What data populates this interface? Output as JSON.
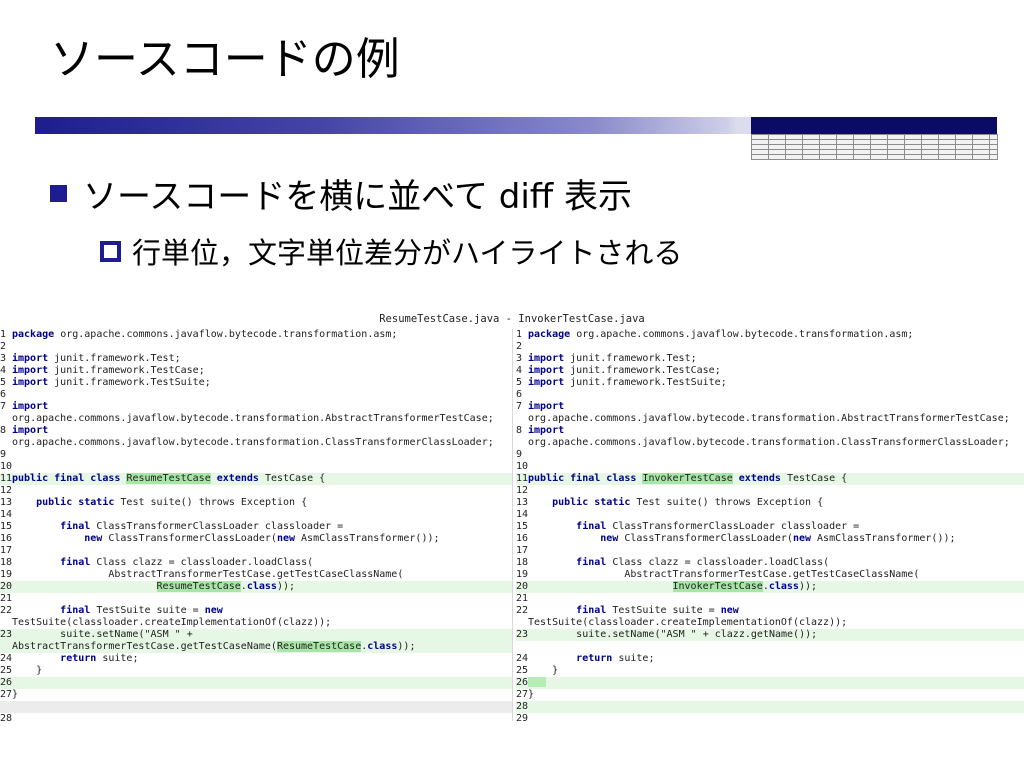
{
  "slide": {
    "title": "ソースコードの例",
    "bullet1": "ソースコードを横に並べて diff 表示",
    "bullet2": "行単位，文字単位差分がハイライトされる"
  },
  "colors": {
    "accent": "#1d1d8f",
    "diff_line_bg": "#e6f7e6",
    "diff_word_bg": "#a8e6a8",
    "keyword": "#00008b"
  },
  "diff": {
    "title": "ResumeTestCase.java - InvokerTestCase.java",
    "left_class": "ResumeTestCase",
    "right_class": "InvokerTestCase",
    "left": [
      {
        "n": "1",
        "t": "package org.apache.commons.javaflow.bytecode.transformation.asm;"
      },
      {
        "n": "2",
        "t": ""
      },
      {
        "n": "3",
        "t": "import junit.framework.Test;"
      },
      {
        "n": "4",
        "t": "import junit.framework.TestCase;"
      },
      {
        "n": "5",
        "t": "import junit.framework.TestSuite;"
      },
      {
        "n": "6",
        "t": ""
      },
      {
        "n": "7",
        "t": "import"
      },
      {
        "n": "",
        "t": "org.apache.commons.javaflow.bytecode.transformation.AbstractTransformerTestCase;"
      },
      {
        "n": "8",
        "t": "import"
      },
      {
        "n": "",
        "t": "org.apache.commons.javaflow.bytecode.transformation.ClassTransformerClassLoader;"
      },
      {
        "n": "9",
        "t": ""
      },
      {
        "n": "10",
        "t": ""
      },
      {
        "n": "11",
        "t": "public final class ResumeTestCase extends TestCase {",
        "hl": true
      },
      {
        "n": "12",
        "t": ""
      },
      {
        "n": "13",
        "t": "    public static Test suite() throws Exception {"
      },
      {
        "n": "14",
        "t": ""
      },
      {
        "n": "15",
        "t": "        final ClassTransformerClassLoader classloader ="
      },
      {
        "n": "16",
        "t": "            new ClassTransformerClassLoader(new AsmClassTransformer());"
      },
      {
        "n": "17",
        "t": ""
      },
      {
        "n": "18",
        "t": "        final Class clazz = classloader.loadClass("
      },
      {
        "n": "19",
        "t": "                AbstractTransformerTestCase.getTestCaseClassName("
      },
      {
        "n": "20",
        "t": "                        ResumeTestCase.class));",
        "hl": true
      },
      {
        "n": "21",
        "t": ""
      },
      {
        "n": "22",
        "t": "        final TestSuite suite = new"
      },
      {
        "n": "",
        "t": "TestSuite(classloader.createImplementationOf(clazz));"
      },
      {
        "n": "23",
        "t": "        suite.setName(\"ASM \" +",
        "hl": true
      },
      {
        "n": "",
        "t": "AbstractTransformerTestCase.getTestCaseName(ResumeTestCase.class));",
        "hl": true
      },
      {
        "n": "24",
        "t": "        return suite;"
      },
      {
        "n": "25",
        "t": "    }"
      },
      {
        "n": "26",
        "t": "",
        "hl": true
      },
      {
        "n": "27",
        "t": "}"
      },
      {
        "n": "",
        "t": "",
        "gap": true
      },
      {
        "n": "28",
        "t": ""
      }
    ],
    "right": [
      {
        "n": "1",
        "t": "package org.apache.commons.javaflow.bytecode.transformation.asm;"
      },
      {
        "n": "2",
        "t": ""
      },
      {
        "n": "3",
        "t": "import junit.framework.Test;"
      },
      {
        "n": "4",
        "t": "import junit.framework.TestCase;"
      },
      {
        "n": "5",
        "t": "import junit.framework.TestSuite;"
      },
      {
        "n": "6",
        "t": ""
      },
      {
        "n": "7",
        "t": "import"
      },
      {
        "n": "",
        "t": "org.apache.commons.javaflow.bytecode.transformation.AbstractTransformerTestCase;"
      },
      {
        "n": "8",
        "t": "import"
      },
      {
        "n": "",
        "t": "org.apache.commons.javaflow.bytecode.transformation.ClassTransformerClassLoader;"
      },
      {
        "n": "9",
        "t": ""
      },
      {
        "n": "10",
        "t": ""
      },
      {
        "n": "11",
        "t": "public final class InvokerTestCase extends TestCase {",
        "hl": true
      },
      {
        "n": "12",
        "t": ""
      },
      {
        "n": "13",
        "t": "    public static Test suite() throws Exception {"
      },
      {
        "n": "14",
        "t": ""
      },
      {
        "n": "15",
        "t": "        final ClassTransformerClassLoader classloader ="
      },
      {
        "n": "16",
        "t": "            new ClassTransformerClassLoader(new AsmClassTransformer());"
      },
      {
        "n": "17",
        "t": ""
      },
      {
        "n": "18",
        "t": "        final Class clazz = classloader.loadClass("
      },
      {
        "n": "19",
        "t": "                AbstractTransformerTestCase.getTestCaseClassName("
      },
      {
        "n": "20",
        "t": "                        InvokerTestCase.class));",
        "hl": true
      },
      {
        "n": "21",
        "t": ""
      },
      {
        "n": "22",
        "t": "        final TestSuite suite = new"
      },
      {
        "n": "",
        "t": "TestSuite(classloader.createImplementationOf(clazz));"
      },
      {
        "n": "23",
        "t": "        suite.setName(\"ASM \" + clazz.getName());",
        "hl": true
      },
      {
        "n": "",
        "t": ""
      },
      {
        "n": "24",
        "t": "        return suite;"
      },
      {
        "n": "25",
        "t": "    }"
      },
      {
        "n": "26",
        "t": "",
        "hl": true,
        "block": true
      },
      {
        "n": "27",
        "t": "}"
      },
      {
        "n": "28",
        "t": "",
        "hl": true
      },
      {
        "n": "29",
        "t": ""
      }
    ]
  }
}
